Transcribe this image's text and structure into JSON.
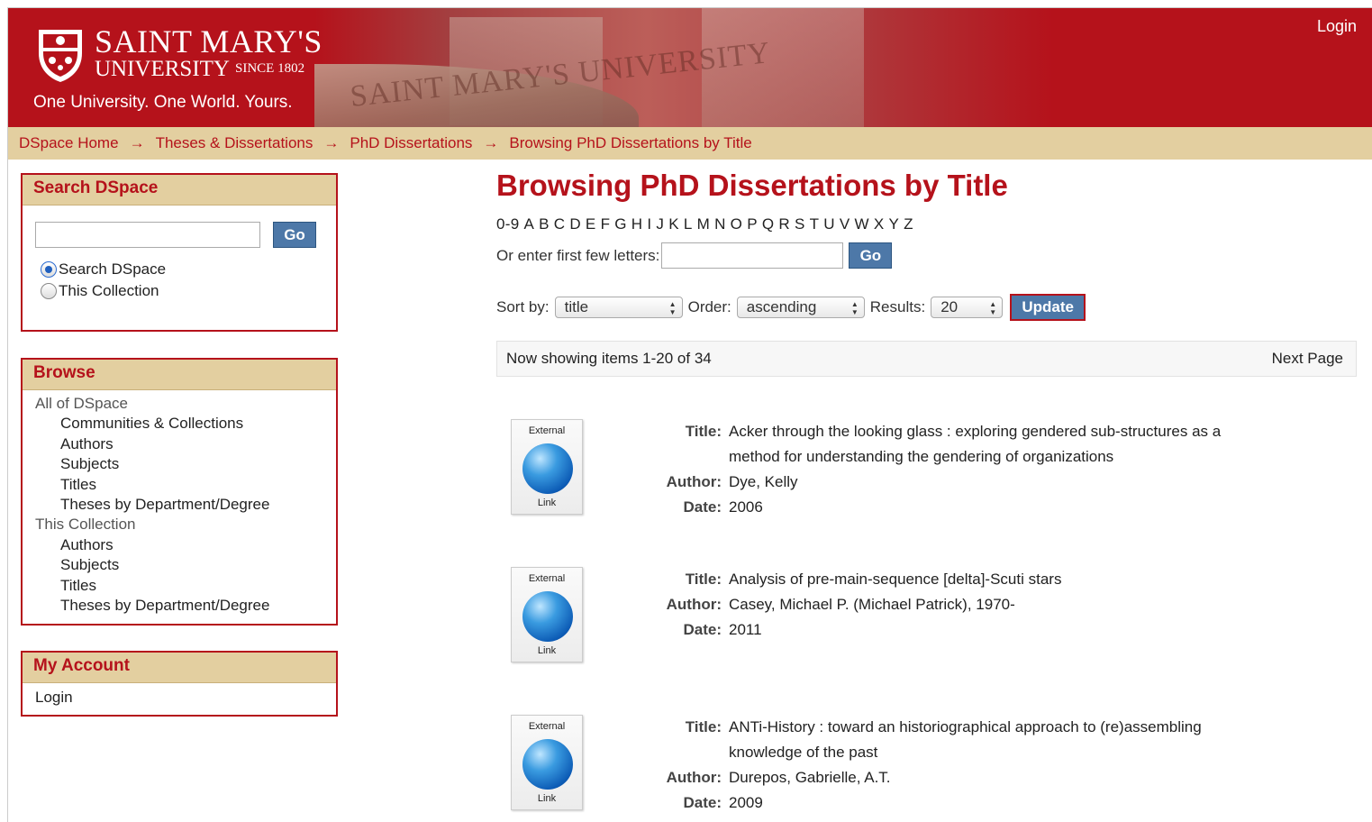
{
  "header": {
    "name_line1": "SAINT MARY'S",
    "name_line2": "UNIVERSITY",
    "since": "SINCE 1802",
    "tagline": "One University. One World. Yours.",
    "photo_text": "SAINT MARY'S UNIVERSITY",
    "login": "Login"
  },
  "breadcrumb": [
    "DSpace Home",
    "Theses & Dissertations",
    "PhD Dissertations",
    "Browsing PhD Dissertations by Title"
  ],
  "breadcrumb_sep": "→",
  "sidebar": {
    "search": {
      "title": "Search DSpace",
      "go": "Go",
      "options": [
        "Search DSpace",
        "This Collection"
      ]
    },
    "browse": {
      "title": "Browse",
      "all_label": "All of DSpace",
      "all_items": [
        "Communities & Collections",
        "Authors",
        "Subjects",
        "Titles",
        "Theses by Department/Degree"
      ],
      "coll_label": "This Collection",
      "coll_items": [
        "Authors",
        "Subjects",
        "Titles",
        "Theses by Department/Degree"
      ]
    },
    "account": {
      "title": "My Account",
      "login": "Login"
    }
  },
  "main": {
    "title": "Browsing PhD Dissertations by Title",
    "alpha": [
      "0-9",
      "A",
      "B",
      "C",
      "D",
      "E",
      "F",
      "G",
      "H",
      "I",
      "J",
      "K",
      "L",
      "M",
      "N",
      "O",
      "P",
      "Q",
      "R",
      "S",
      "T",
      "U",
      "V",
      "W",
      "X",
      "Y",
      "Z"
    ],
    "first_letters_label": "Or enter first few letters:",
    "go": "Go",
    "sort_label": "Sort by:",
    "sort_value": "title",
    "order_label": "Order:",
    "order_value": "ascending",
    "results_label": "Results:",
    "results_value": "20",
    "update": "Update",
    "showing": "Now showing items 1-20 of 34",
    "next_page": "Next Page"
  },
  "item_labels": {
    "title": "Title:",
    "author": "Author:",
    "date": "Date:"
  },
  "thumb": {
    "top": "External",
    "bottom": "Link"
  },
  "items": [
    {
      "title": "Acker through the looking glass : exploring gendered sub-structures as a method for understanding the gendering of organizations",
      "author": "Dye, Kelly",
      "date": "2006"
    },
    {
      "title": "Analysis of pre-main-sequence [delta]-Scuti stars",
      "author": "Casey, Michael P. (Michael Patrick), 1970-",
      "date": "2011"
    },
    {
      "title": "ANTi-History : toward an historiographical approach to (re)assembling knowledge of the past",
      "author": "Durepos, Gabrielle, A.T.",
      "date": "2009"
    }
  ]
}
